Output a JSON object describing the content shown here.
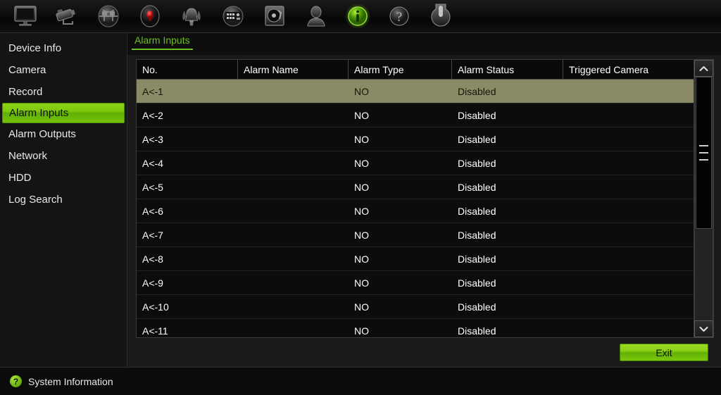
{
  "toolbar": {
    "icons": [
      {
        "name": "monitor-icon",
        "label": "Playback / Monitor"
      },
      {
        "name": "camera-icon",
        "label": "Camera"
      },
      {
        "name": "export-icon",
        "label": "Export"
      },
      {
        "name": "record-icon",
        "label": "Manual Record"
      },
      {
        "name": "alarm-bell-icon",
        "label": "Alarm"
      },
      {
        "name": "settings-panel-icon",
        "label": "System Configuration"
      },
      {
        "name": "hdd-icon",
        "label": "HDD Management"
      },
      {
        "name": "user-icon",
        "label": "User Management"
      },
      {
        "name": "info-icon",
        "label": "System Information"
      },
      {
        "name": "help-icon",
        "label": "Help"
      },
      {
        "name": "power-icon",
        "label": "Shutdown"
      }
    ],
    "active_icon": "info-icon"
  },
  "sidebar": {
    "items": [
      {
        "label": "Device Info",
        "active": false
      },
      {
        "label": "Camera",
        "active": false
      },
      {
        "label": "Record",
        "active": false
      },
      {
        "label": "Alarm Inputs",
        "active": true
      },
      {
        "label": "Alarm Outputs",
        "active": false
      },
      {
        "label": "Network",
        "active": false
      },
      {
        "label": "HDD",
        "active": false
      },
      {
        "label": "Log Search",
        "active": false
      }
    ]
  },
  "main": {
    "tab": "Alarm Inputs",
    "table": {
      "columns": [
        "No.",
        "Alarm Name",
        "Alarm Type",
        "Alarm Status",
        "Triggered Camera"
      ],
      "rows": [
        {
          "no": "A<-1",
          "alarm_name": "",
          "alarm_type": "NO",
          "alarm_status": "Disabled",
          "triggered_camera": "",
          "selected": true
        },
        {
          "no": "A<-2",
          "alarm_name": "",
          "alarm_type": "NO",
          "alarm_status": "Disabled",
          "triggered_camera": "",
          "selected": false
        },
        {
          "no": "A<-3",
          "alarm_name": "",
          "alarm_type": "NO",
          "alarm_status": "Disabled",
          "triggered_camera": "",
          "selected": false
        },
        {
          "no": "A<-4",
          "alarm_name": "",
          "alarm_type": "NO",
          "alarm_status": "Disabled",
          "triggered_camera": "",
          "selected": false
        },
        {
          "no": "A<-5",
          "alarm_name": "",
          "alarm_type": "NO",
          "alarm_status": "Disabled",
          "triggered_camera": "",
          "selected": false
        },
        {
          "no": "A<-6",
          "alarm_name": "",
          "alarm_type": "NO",
          "alarm_status": "Disabled",
          "triggered_camera": "",
          "selected": false
        },
        {
          "no": "A<-7",
          "alarm_name": "",
          "alarm_type": "NO",
          "alarm_status": "Disabled",
          "triggered_camera": "",
          "selected": false
        },
        {
          "no": "A<-8",
          "alarm_name": "",
          "alarm_type": "NO",
          "alarm_status": "Disabled",
          "triggered_camera": "",
          "selected": false
        },
        {
          "no": "A<-9",
          "alarm_name": "",
          "alarm_type": "NO",
          "alarm_status": "Disabled",
          "triggered_camera": "",
          "selected": false
        },
        {
          "no": "A<-10",
          "alarm_name": "",
          "alarm_type": "NO",
          "alarm_status": "Disabled",
          "triggered_camera": "",
          "selected": false
        },
        {
          "no": "A<-11",
          "alarm_name": "",
          "alarm_type": "NO",
          "alarm_status": "Disabled",
          "triggered_camera": "",
          "selected": false
        }
      ]
    },
    "scrollbar": {
      "up_icon": "chevron-up-icon",
      "down_icon": "chevron-down-icon",
      "grip_count": 3
    },
    "exit_label": "Exit"
  },
  "statusbar": {
    "icon": "help-circle-icon",
    "icon_glyph": "?",
    "text": "System Information"
  },
  "colors": {
    "accent_green": "#7cc70c",
    "tab_green": "#6cbf20",
    "selected_row": "#8a8a66",
    "panel_bg": "#1a1a1a",
    "table_bg": "#0c0c0c"
  }
}
